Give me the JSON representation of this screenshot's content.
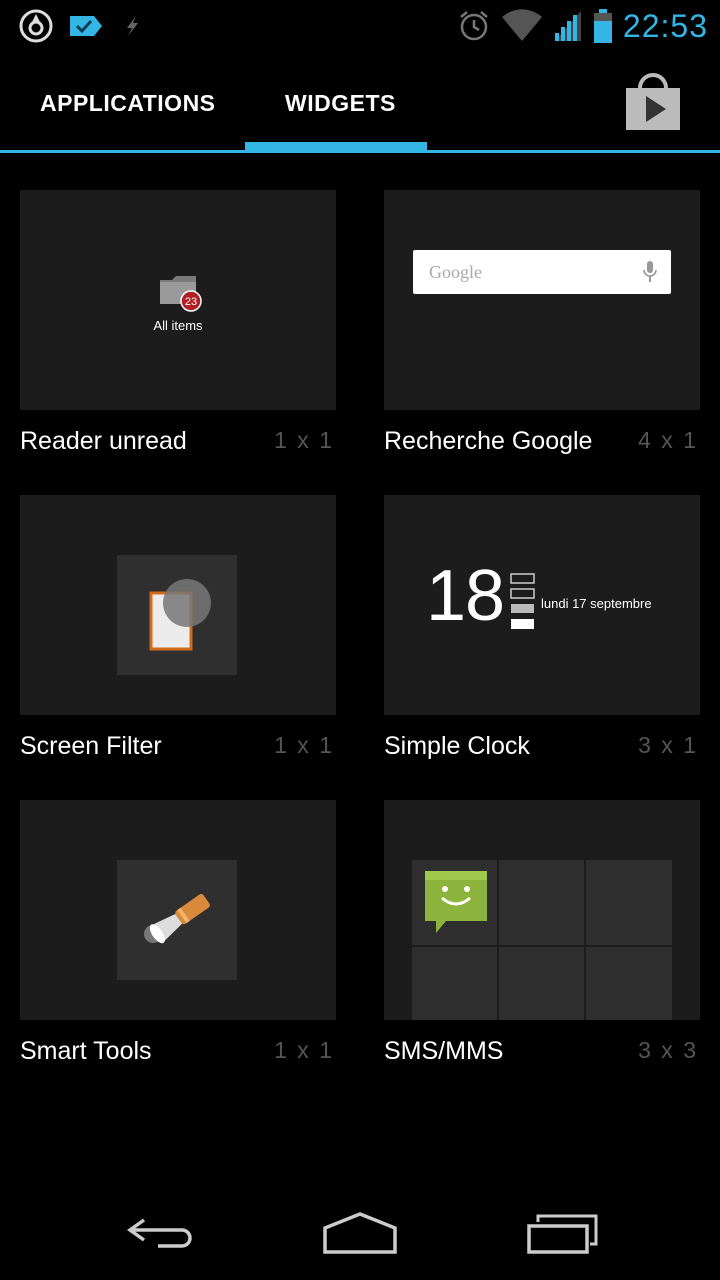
{
  "status_bar": {
    "time": "22:53",
    "accent_color": "#33b5e5",
    "left_icons": [
      "sync-circle-icon",
      "tag-check-icon",
      "usb-debug-icon"
    ],
    "right_icons": [
      "alarm-icon",
      "wifi-icon",
      "signal-icon",
      "battery-icon"
    ]
  },
  "tabs": [
    {
      "label": "APPLICATIONS",
      "selected": false
    },
    {
      "label": "WIDGETS",
      "selected": true
    }
  ],
  "store_button_icon": "play-store-icon",
  "widgets": [
    {
      "name": "Reader unread",
      "size": "1 x 1",
      "preview": {
        "label": "All items",
        "badge": "23"
      }
    },
    {
      "name": "Recherche Google",
      "size": "4 x 1",
      "preview": {
        "logo": "Google"
      }
    },
    {
      "name": "Screen Filter",
      "size": "1 x 1"
    },
    {
      "name": "Simple Clock",
      "size": "3 x 1",
      "preview": {
        "hour": "18",
        "date": "lundi 17 septembre"
      }
    },
    {
      "name": "Smart Tools",
      "size": "1 x 1"
    },
    {
      "name": "SMS/MMS",
      "size": "3 x 3"
    }
  ],
  "nav_bar": {
    "back": "back-icon",
    "home": "home-icon",
    "recents": "recent-apps-icon"
  }
}
